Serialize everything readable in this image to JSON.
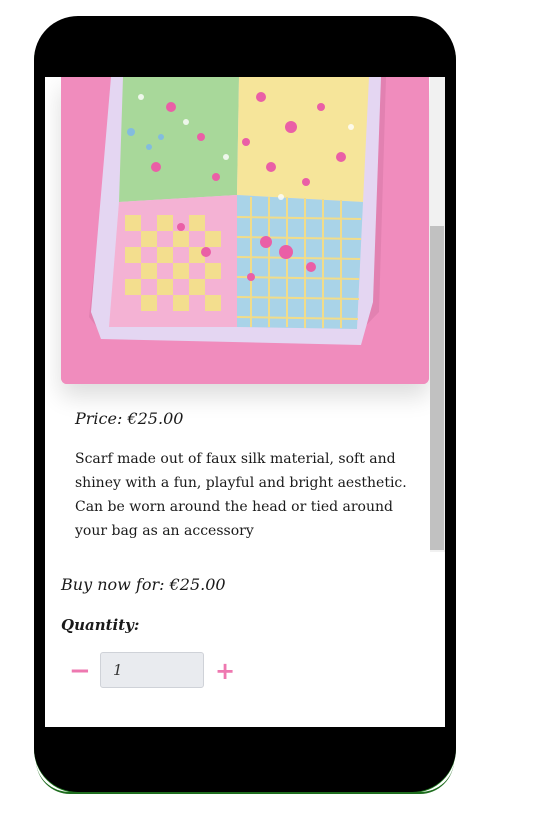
{
  "product": {
    "image_alt": "Patchwork floral and checkered silk scarf on pink background",
    "price_text": "Price: €25.00",
    "description": "Scarf made out of faux silk material, soft and shiney with a fun, playful and bright aesthetic. Can be worn around the head or tied around your bag as an accessory"
  },
  "purchase": {
    "buy_now_text": "Buy now for: €25.00",
    "quantity_label": "Quantity:",
    "quantity_value": "1",
    "minus_symbol": "−",
    "plus_symbol": "+"
  },
  "colors": {
    "accent": "#ee78b0",
    "image_background": "#f08cbd",
    "phone_frame": "#000000"
  },
  "icons": {
    "decrement": "minus-icon",
    "increment": "plus-icon"
  }
}
